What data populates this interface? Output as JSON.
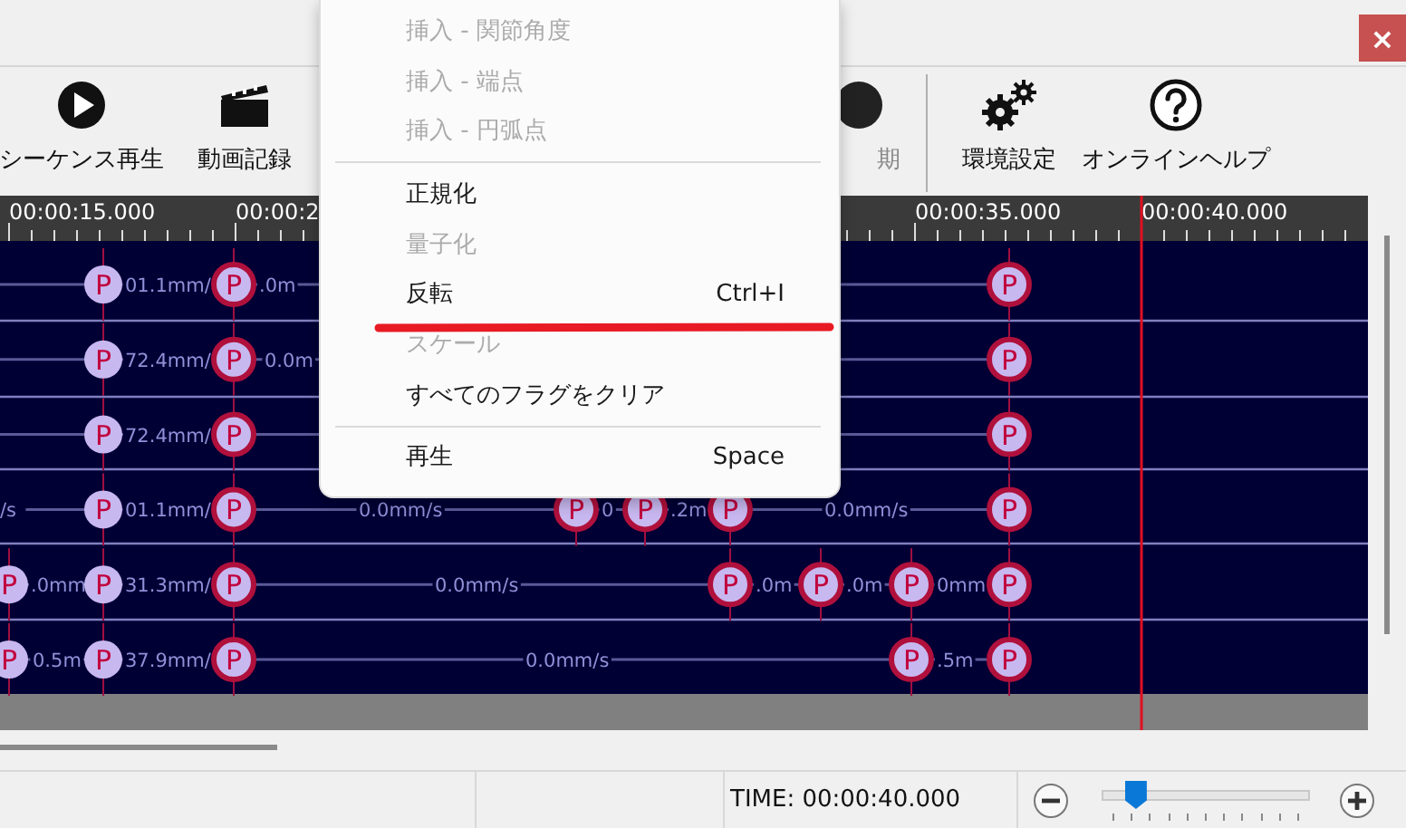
{
  "window": {
    "close": "×"
  },
  "toolbar": [
    {
      "kind": "play",
      "label": "シーケンス再生"
    },
    {
      "kind": "clapper",
      "label": "動画記録"
    },
    {
      "kind": "sync",
      "label": "期"
    },
    {
      "kind": "gears",
      "label": "環境設定"
    },
    {
      "kind": "help",
      "label": "オンラインヘルプ"
    }
  ],
  "ruler": {
    "labels": [
      "00:00:15.000",
      "00:00:2",
      "00:00:35.000",
      "00:00:40.000"
    ]
  },
  "tracks": [
    {
      "items": [
        {
          "kind": "waypoint",
          "label": "P"
        },
        {
          "kind": "speed",
          "label": "01.1mm/"
        },
        {
          "kind": "keyframe",
          "label": "P"
        },
        {
          "kind": "speed",
          "label": ".0m"
        },
        {
          "kind": "keyframe",
          "label": "P"
        }
      ]
    },
    {
      "items": [
        {
          "kind": "waypoint",
          "label": "P"
        },
        {
          "kind": "speed",
          "label": "72.4mm/"
        },
        {
          "kind": "keyframe",
          "label": "P"
        },
        {
          "kind": "speed",
          "label": "0.0m"
        },
        {
          "kind": "keyframe",
          "label": "P"
        }
      ]
    },
    {
      "items": [
        {
          "kind": "waypoint",
          "label": "P"
        },
        {
          "kind": "speed",
          "label": "72.4mm/"
        },
        {
          "kind": "keyframe",
          "label": "P"
        },
        {
          "kind": "keyframe",
          "label": "P"
        }
      ]
    },
    {
      "items": [
        {
          "kind": "speed",
          "label": "/s"
        },
        {
          "kind": "waypoint",
          "label": "P"
        },
        {
          "kind": "speed",
          "label": "01.1mm/"
        },
        {
          "kind": "keyframe",
          "label": "P"
        },
        {
          "kind": "speed",
          "label": "0.0mm/s"
        },
        {
          "kind": "keyframe",
          "label": "P"
        },
        {
          "kind": "speed",
          "label": "0"
        },
        {
          "kind": "keyframe",
          "label": "P"
        },
        {
          "kind": "speed",
          "label": ".2m"
        },
        {
          "kind": "keyframe",
          "label": "P"
        },
        {
          "kind": "speed",
          "label": "0.0mm/s"
        },
        {
          "kind": "keyframe",
          "label": "P"
        }
      ]
    },
    {
      "items": [
        {
          "kind": "waypoint",
          "label": "P"
        },
        {
          "kind": "speed",
          "label": ".0mm"
        },
        {
          "kind": "waypoint",
          "label": "P"
        },
        {
          "kind": "speed",
          "label": "31.3mm/"
        },
        {
          "kind": "keyframe",
          "label": "P"
        },
        {
          "kind": "speed",
          "label": "0.0mm/s"
        },
        {
          "kind": "keyframe",
          "label": "P"
        },
        {
          "kind": "speed",
          "label": ".0m"
        },
        {
          "kind": "keyframe",
          "label": "P"
        },
        {
          "kind": "speed",
          "label": ".0m"
        },
        {
          "kind": "keyframe",
          "label": "P"
        },
        {
          "kind": "speed",
          "label": "0mm"
        },
        {
          "kind": "keyframe",
          "label": "P"
        }
      ]
    },
    {
      "items": [
        {
          "kind": "waypoint",
          "label": "P"
        },
        {
          "kind": "speed",
          "label": "0.5m"
        },
        {
          "kind": "waypoint",
          "label": "P"
        },
        {
          "kind": "speed",
          "label": "37.9mm/"
        },
        {
          "kind": "keyframe",
          "label": "P"
        },
        {
          "kind": "speed",
          "label": "0.0mm/s"
        },
        {
          "kind": "keyframe",
          "label": "P"
        },
        {
          "kind": "speed",
          "label": ".5m"
        },
        {
          "kind": "keyframe",
          "label": "P"
        }
      ]
    }
  ],
  "context_menu": {
    "items": [
      {
        "kind": "item",
        "label": "挿入 - 関節角度",
        "disabled": true
      },
      {
        "kind": "item",
        "label": "挿入 - 端点",
        "disabled": true
      },
      {
        "kind": "item",
        "label": "挿入 - 円弧点",
        "disabled": true
      },
      {
        "kind": "separator"
      },
      {
        "kind": "item",
        "label": "正規化",
        "disabled": false
      },
      {
        "kind": "item",
        "label": "量子化",
        "disabled": true
      },
      {
        "kind": "item",
        "label": "反転",
        "shortcut": "Ctrl+I",
        "disabled": false
      },
      {
        "kind": "item",
        "label": "スケール",
        "disabled": true
      },
      {
        "kind": "item",
        "label": "すべてのフラグをクリア",
        "disabled": false
      },
      {
        "kind": "separator"
      },
      {
        "kind": "item",
        "label": "再生",
        "shortcut": "Space",
        "disabled": false
      }
    ]
  },
  "status_bar": {
    "time": "TIME: 00:00:40.000",
    "zoom": {
      "level": 0.13
    }
  }
}
